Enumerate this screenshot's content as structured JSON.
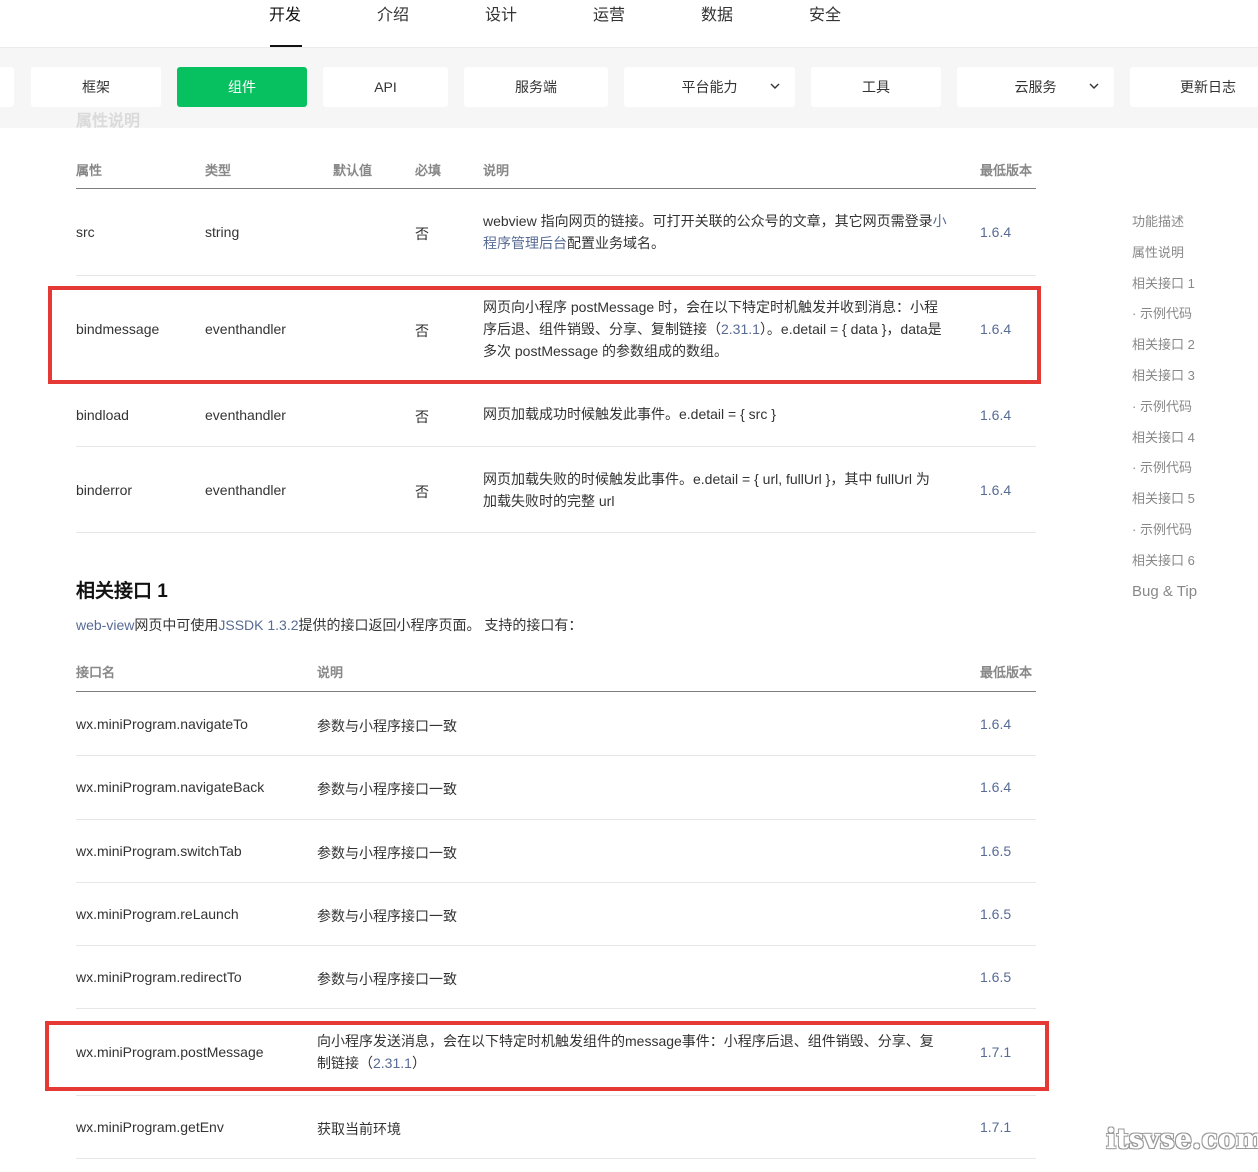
{
  "top_nav": [
    "开发",
    "介绍",
    "设计",
    "运营",
    "数据",
    "安全"
  ],
  "sub_nav": {
    "tabs": [
      {
        "label": "框架"
      },
      {
        "label": "组件"
      },
      {
        "label": "API"
      },
      {
        "label": "服务端"
      },
      {
        "label": "平台能力",
        "chevron": "chevron-down-icon"
      },
      {
        "label": "工具"
      },
      {
        "label": "云服务",
        "chevron": "chevron-down-icon"
      },
      {
        "label": "更新日志"
      }
    ],
    "active": "组件"
  },
  "ghost_heading": "属性说明",
  "props_table": {
    "headers": [
      "属性",
      "类型",
      "默认值",
      "必填",
      "说明",
      "最低版本"
    ],
    "rows": [
      {
        "name": "src",
        "type": "string",
        "default": "",
        "required": "否",
        "desc_a": "webview 指向网页的链接。可打开关联的公众号的文章，其它网页需登录",
        "desc_link": "小程序管理后台",
        "desc_b": "配置业务域名。",
        "version": "1.6.4"
      },
      {
        "name": "bindmessage",
        "type": "eventhandler",
        "default": "",
        "required": "否",
        "desc_a": "网页向小程序 postMessage 时，会在以下特定时机触发并收到消息：小程序后退、组件销毁、分享、复制链接（",
        "desc_link": "2.31.1",
        "desc_b": "）。e.detail = { data }，data是多次 postMessage 的参数组成的数组。",
        "version": "1.6.4"
      },
      {
        "name": "bindload",
        "type": "eventhandler",
        "default": "",
        "required": "否",
        "desc_a": "网页加载成功时候触发此事件。e.detail = { src }",
        "desc_link": "",
        "desc_b": "",
        "version": "1.6.4"
      },
      {
        "name": "binderror",
        "type": "eventhandler",
        "default": "",
        "required": "否",
        "desc_a": "网页加载失败的时候触发此事件。e.detail = { url, fullUrl }，其中 fullUrl 为加载失败时的完整 url",
        "desc_link": "",
        "desc_b": "",
        "version": "1.6.4"
      }
    ]
  },
  "section1": {
    "title": "相关接口 1",
    "intro_link1": "web-view",
    "intro_text1": "网页中可使用",
    "intro_link2": "JSSDK 1.3.2",
    "intro_text2": "提供的接口返回小程序页面。 支持的接口有："
  },
  "api_table": {
    "headers": [
      "接口名",
      "说明",
      "最低版本"
    ],
    "rows": [
      {
        "name": "wx.miniProgram.navigateTo",
        "desc_a": "参数与小程序接口一致",
        "desc_link": "",
        "desc_b": "",
        "version": "1.6.4"
      },
      {
        "name": "wx.miniProgram.navigateBack",
        "desc_a": "参数与小程序接口一致",
        "desc_link": "",
        "desc_b": "",
        "version": "1.6.4"
      },
      {
        "name": "wx.miniProgram.switchTab",
        "desc_a": "参数与小程序接口一致",
        "desc_link": "",
        "desc_b": "",
        "version": "1.6.5"
      },
      {
        "name": "wx.miniProgram.reLaunch",
        "desc_a": "参数与小程序接口一致",
        "desc_link": "",
        "desc_b": "",
        "version": "1.6.5"
      },
      {
        "name": "wx.miniProgram.redirectTo",
        "desc_a": "参数与小程序接口一致",
        "desc_link": "",
        "desc_b": "",
        "version": "1.6.5"
      },
      {
        "name": "wx.miniProgram.postMessage",
        "desc_a": "向小程序发送消息，会在以下特定时机触发组件的message事件：小程序后退、组件销毁、分享、复制链接（",
        "desc_link": "2.31.1",
        "desc_b": "）",
        "version": "1.7.1"
      },
      {
        "name": "wx.miniProgram.getEnv",
        "desc_a": "获取当前环境",
        "desc_link": "",
        "desc_b": "",
        "version": "1.7.1"
      }
    ]
  },
  "toc": [
    "功能描述",
    "属性说明",
    "相关接口 1",
    "· 示例代码",
    "相关接口 2",
    "相关接口 3",
    "· 示例代码",
    "相关接口 4",
    "· 示例代码",
    "相关接口 5",
    "· 示例代码",
    "相关接口 6",
    "Bug & Tip"
  ],
  "watermark": "itsvse.com",
  "colors": {
    "accent": "#07c160",
    "link": "#576b95",
    "highlight": "#e53935"
  }
}
